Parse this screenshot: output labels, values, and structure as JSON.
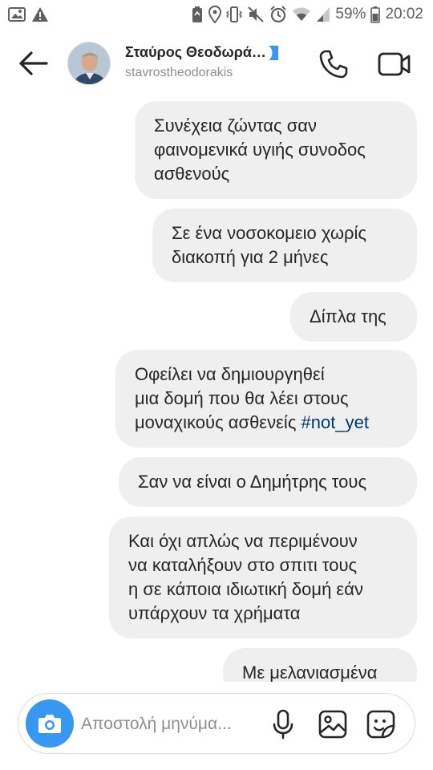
{
  "status_bar": {
    "battery_percent": "59%",
    "time": "20:02",
    "left_icons": [
      "gallery-notification-icon",
      "warning-icon"
    ],
    "right_icons": [
      "recycle-icon",
      "location-icon",
      "vibrate-icon",
      "mute-icon",
      "alarm-icon",
      "wifi-icon",
      "signal-icon",
      "battery-icon"
    ]
  },
  "header": {
    "display_name": "Σταύρος Θεοδωρά…",
    "username": "stavrostheodorakis",
    "verified_icon": "verified-badge-icon",
    "back_icon": "back-arrow-icon",
    "call_icon": "phone-icon",
    "video_icon": "video-camera-icon"
  },
  "messages": [
    {
      "lines": [
        "Συνέχεια ζώντας σαν",
        "φαινομενικά υγιής συνοδος",
        "ασθενούς"
      ]
    },
    {
      "lines": [
        "Σε ένα νοσοκομειο χωρίς",
        "διακοπή για 2 μήνες"
      ]
    },
    {
      "lines": [
        "Δίπλα της"
      ]
    },
    {
      "lines": [
        "Οφείλει να δημιουργηθεί",
        "μια δομή που θα λέει στους",
        "μοναχικούς ασθενείς"
      ],
      "hashtag": "#not_yet"
    },
    {
      "lines": [
        "Σαν να είναι ο Δημήτρης τους"
      ]
    },
    {
      "lines": [
        "Και όχι απλώς να περιμένουν",
        "να καταλήξουν στο σπιτι τους",
        "η σε κάποια ιδιωτική δομή εάν",
        "υπάρχουν τα χρήματα"
      ]
    },
    {
      "lines": [
        "Με μελανιασμένα"
      ]
    }
  ],
  "composer": {
    "placeholder": "Αποστολή μηνύμα...",
    "camera_icon": "camera-icon",
    "mic_icon": "microphone-icon",
    "gallery_icon": "image-gallery-icon",
    "sticker_icon": "sticker-icon"
  },
  "colors": {
    "bubble": "#efefef",
    "camera_button": "#3897f0",
    "hashtag": "#00376b",
    "verified": "#3897f0"
  }
}
